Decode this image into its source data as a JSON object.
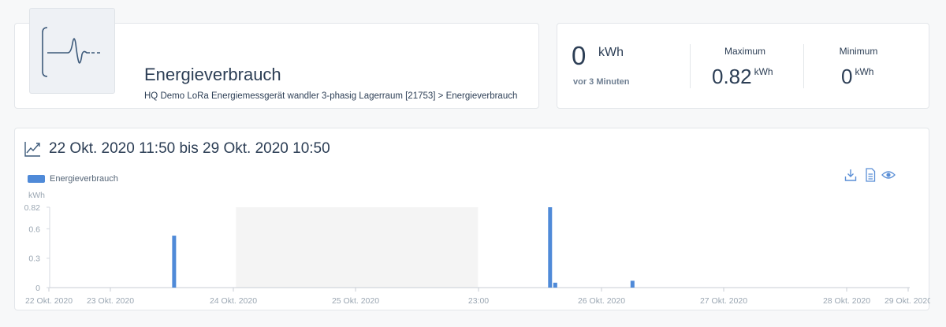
{
  "header": {
    "title": "Energieverbrauch",
    "breadcrumb": "HQ Demo LoRa Energiemessgerät wandler 3-phasig Lagerraum [21753] > Energieverbrauch",
    "tile_icon": "sensor-waveform-icon"
  },
  "stats": {
    "current": {
      "value": "0",
      "unit": "kWh",
      "time": "vor 3 Minuten"
    },
    "maximum": {
      "label": "Maximum",
      "value": "0.82",
      "unit": "kWh"
    },
    "minimum": {
      "label": "Minimum",
      "value": "0",
      "unit": "kWh"
    }
  },
  "chart": {
    "title": "22 Okt. 2020 11:50 bis 29 Okt. 2020 10:50",
    "tools": [
      "download-icon",
      "document-icon",
      "eye-icon"
    ]
  },
  "colors": {
    "accent": "#4f8ad8",
    "text": "#2c3e55",
    "highlight_band": "#f4f4f4"
  },
  "chart_data": {
    "type": "bar",
    "title": "22 Okt. 2020 11:50 bis 29 Okt. 2020 10:50",
    "ylabel": "kWh",
    "ylim": [
      0,
      0.82
    ],
    "yticks": [
      0,
      0.3,
      0.6,
      0.82
    ],
    "xticks": [
      "22 Okt. 2020",
      "23 Okt. 2020",
      "24 Okt. 2020",
      "25 Okt. 2020",
      "23:00",
      "26 Okt. 2020",
      "27 Okt. 2020",
      "28 Okt. 2020",
      "29 Okt. 2020"
    ],
    "x_range": [
      "2020-10-22 11:50",
      "2020-10-29 10:50"
    ],
    "legend": "top-left",
    "highlight_band": [
      "2020-10-24 00:00",
      "2020-10-25 23:00"
    ],
    "series": [
      {
        "name": "Energieverbrauch",
        "color": "#4f8ad8",
        "points": [
          {
            "x": "2020-10-23 12:00",
            "y": 0.53
          },
          {
            "x": "2020-10-26 13:00",
            "y": 0.82
          },
          {
            "x": "2020-10-26 14:00",
            "y": 0.05
          },
          {
            "x": "2020-10-27 05:00",
            "y": 0.07
          }
        ]
      }
    ]
  }
}
